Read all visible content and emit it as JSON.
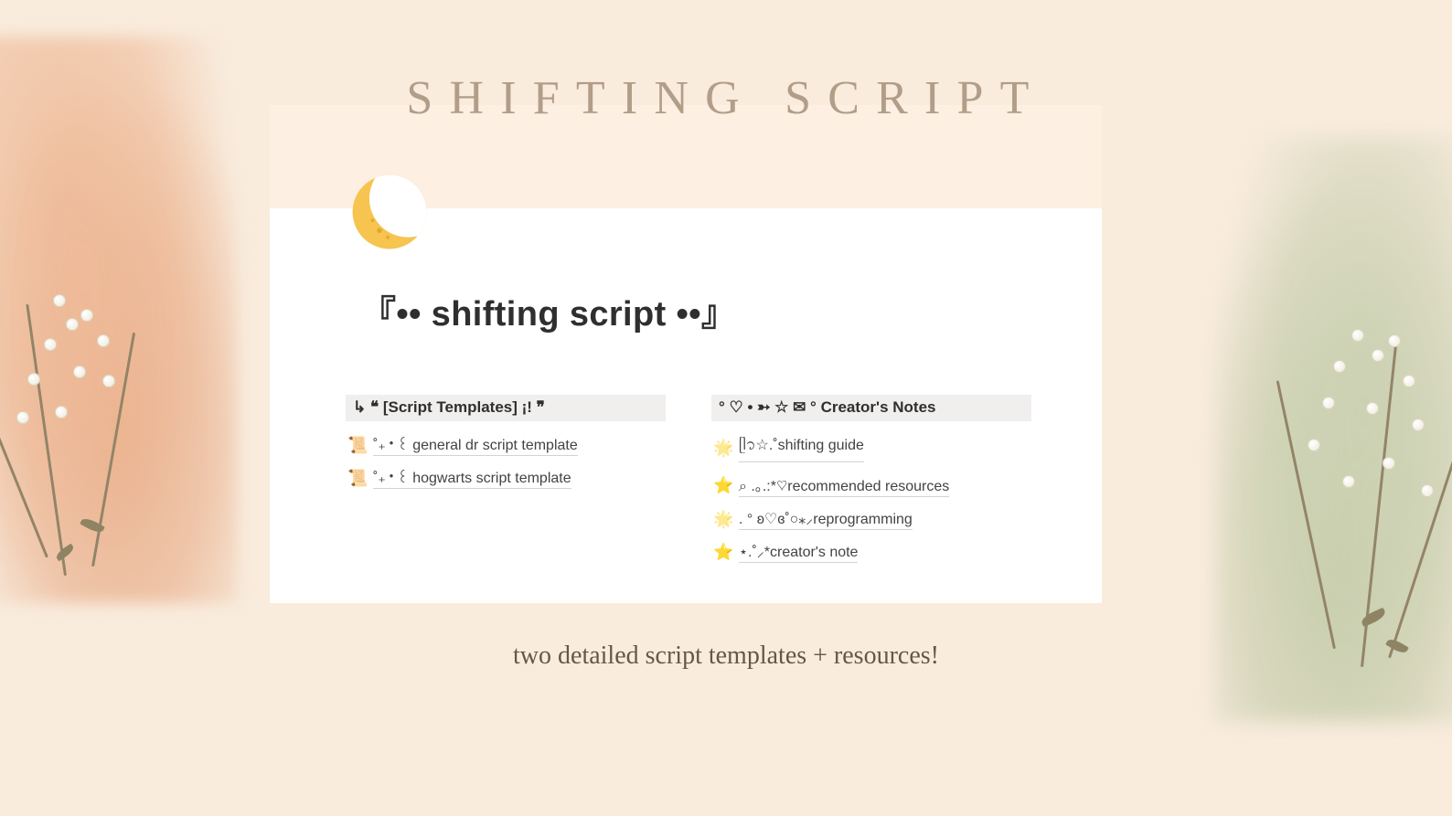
{
  "heading": "SHIFTING SCRIPT",
  "panel_title": "『•• shifting script ••』",
  "caption": "two detailed script templates + resources!",
  "columns": {
    "left": {
      "header": "↳ ❝ [Script Templates] ¡! ❞",
      "items": [
        {
          "icon": "📜",
          "label": "˚₊‧꒰  general dr script template"
        },
        {
          "icon": "📜",
          "label": "˚₊‧꒰  hogwarts script template"
        }
      ]
    },
    "right": {
      "header": "° ♡ • ➳ ☆ ✉ ° Creator's Notes",
      "items": [
        {
          "icon": "🌟",
          "dim": true,
          "label": "ᥫ᭡☆.˚shifting guide"
        },
        {
          "icon": "⭐",
          "dim": false,
          "label": "⌕ .｡.:*♡recommended resources"
        },
        {
          "icon": "🌟",
          "dim": true,
          "label": ". ° ʚ♡ɞ˚○⁎⸝reprogramming"
        },
        {
          "icon": "⭐",
          "dim": false,
          "label": "⋆.˚⸝*creator's note"
        }
      ]
    }
  }
}
